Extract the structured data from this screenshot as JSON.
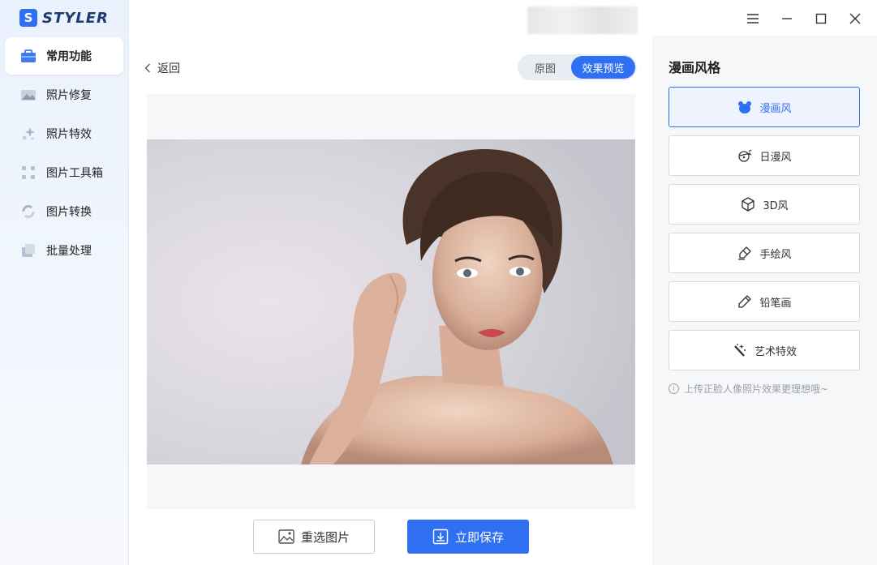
{
  "app": {
    "logo_letter": "S",
    "logo_text": "STYLER"
  },
  "sidebar": {
    "items": [
      {
        "label": "常用功能",
        "icon": "toolbox-icon",
        "active": true
      },
      {
        "label": "照片修复",
        "icon": "photo-repair-icon",
        "active": false
      },
      {
        "label": "照片特效",
        "icon": "sparkle-effects-icon",
        "active": false
      },
      {
        "label": "图片工具箱",
        "icon": "grid-tools-icon",
        "active": false
      },
      {
        "label": "图片转换",
        "icon": "convert-icon",
        "active": false
      },
      {
        "label": "批量处理",
        "icon": "batch-icon",
        "active": false
      }
    ]
  },
  "window_controls": [
    "menu-icon",
    "minimize-icon",
    "maximize-icon",
    "close-icon"
  ],
  "main": {
    "back_label": "返回",
    "view_toggle": {
      "original": "原图",
      "preview": "效果预览",
      "selected": "preview"
    },
    "buttons": {
      "reselect": "重选图片",
      "save": "立即保存"
    }
  },
  "panel": {
    "title": "漫画风格",
    "styles": [
      {
        "label": "漫画风",
        "icon": "bear-icon",
        "active": true
      },
      {
        "label": "日漫风",
        "icon": "ninja-icon",
        "active": false
      },
      {
        "label": "3D风",
        "icon": "cube-icon",
        "active": false
      },
      {
        "label": "手绘风",
        "icon": "eraser-brush-icon",
        "active": false
      },
      {
        "label": "铅笔画",
        "icon": "pencil-icon",
        "active": false
      },
      {
        "label": "艺术特效",
        "icon": "magic-wand-icon",
        "active": false
      }
    ],
    "tip": "上传正脸人像照片效果更理想哦~"
  },
  "colors": {
    "accent": "#2f6ff2",
    "panel_bg": "#f6f7f9",
    "sidebar_bg": "#eaf2fd"
  }
}
